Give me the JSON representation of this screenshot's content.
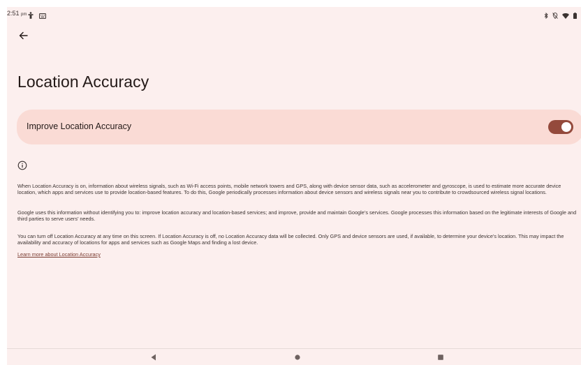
{
  "status_bar": {
    "time": "2:51",
    "ampm": "pm",
    "left_icons": [
      "accessibility-icon",
      "keyboard-icon"
    ],
    "right_icons": [
      "bluetooth-icon",
      "location-off-icon",
      "wifi-icon",
      "battery-icon"
    ]
  },
  "header": {
    "back_icon": "arrow-back-icon",
    "title": "Location Accuracy"
  },
  "toggle": {
    "label": "Improve Location Accuracy",
    "checked": true,
    "color": "#944a3c"
  },
  "info": {
    "icon": "info-icon",
    "paragraphs": [
      "When Location Accuracy is on, information about wireless signals, such as Wi-Fi access points, mobile network towers and GPS, along with device sensor data, such as accelerometer and gyroscope, is used to estimate more accurate device location, which apps and services use to provide location-based features. To do this, Google periodically processes information about device sensors and wireless signals near you to contribute to crowdsourced wireless signal locations.",
      "Google uses this information without identifying you to: improve location accuracy and location-based services; and improve, provide and maintain Google’s services. Google processes this information based on the legitimate interests of Google and third parties to serve users’ needs.",
      "You can turn off Location Accuracy at any time on this screen. If Location Accuracy is off, no Location Accuracy data will be collected. Only GPS and device sensors are used, if available, to determine your device’s location. This may impact the availability and accuracy of locations for apps and services such as Google Maps and finding a lost device."
    ],
    "learn_more": "Learn more about Location Accuracy"
  },
  "nav_bar": {
    "buttons": [
      "back-triangle-icon",
      "home-circle-icon",
      "recents-square-icon"
    ]
  },
  "colors": {
    "background": "#fcefee",
    "card": "#fadbd5",
    "accent": "#944a3c"
  }
}
